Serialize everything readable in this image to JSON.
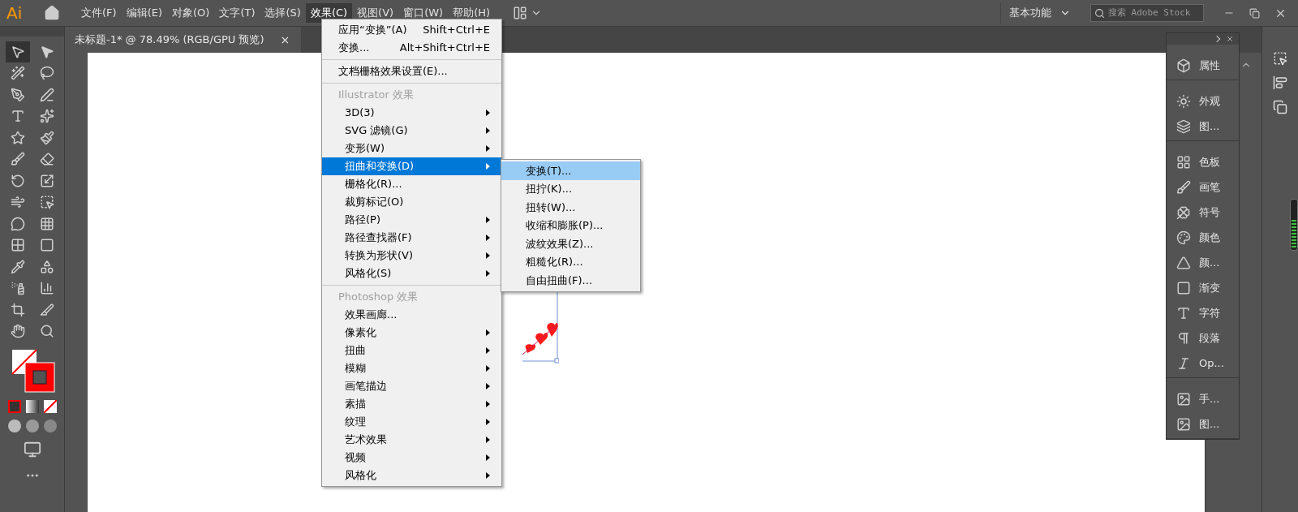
{
  "app_logo": "Ai",
  "menu_bar": [
    {
      "label": "文件(F)",
      "selected": false
    },
    {
      "label": "编辑(E)",
      "selected": false
    },
    {
      "label": "对象(O)",
      "selected": false
    },
    {
      "label": "文字(T)",
      "selected": false
    },
    {
      "label": "选择(S)",
      "selected": false
    },
    {
      "label": "效果(C)",
      "selected": true
    },
    {
      "label": "视图(V)",
      "selected": false
    },
    {
      "label": "窗口(W)",
      "selected": false
    },
    {
      "label": "帮助(H)",
      "selected": false
    }
  ],
  "workspace": "基本功能",
  "search": {
    "placeholder": "搜索 Adobe Stock"
  },
  "document_tab": {
    "title": "未标题-1* @ 78.49% (RGB/GPU 预览)",
    "close": "×"
  },
  "tools": [
    {
      "selected": true
    },
    {
      "selected": false
    },
    {
      "selected": false
    },
    {
      "selected": false
    },
    {
      "selected": false
    },
    {
      "selected": false
    },
    {
      "selected": false
    },
    {
      "selected": false
    },
    {
      "selected": false
    },
    {
      "selected": false
    },
    {
      "selected": false
    },
    {
      "selected": false
    },
    {
      "selected": false
    },
    {
      "selected": false
    },
    {
      "selected": false
    },
    {
      "selected": false
    },
    {
      "selected": false
    },
    {
      "selected": false
    },
    {
      "selected": false
    },
    {
      "selected": false
    },
    {
      "selected": false
    },
    {
      "selected": false
    },
    {
      "selected": false
    },
    {
      "selected": false
    },
    {
      "selected": false
    },
    {
      "selected": false
    },
    {
      "selected": false
    },
    {
      "selected": false
    }
  ],
  "effect_menu": {
    "sections": [
      {
        "items": [
          {
            "label": "应用“变换”(A)",
            "shortcut": "Shift+Ctrl+E",
            "submenu": false,
            "selected": false
          },
          {
            "label": "变换...",
            "shortcut": "Alt+Shift+Ctrl+E",
            "submenu": false,
            "selected": false
          }
        ]
      },
      {
        "items": [
          {
            "label": "文档栅格效果设置(E)...",
            "submenu": false,
            "selected": false
          }
        ]
      },
      {
        "header": "Illustrator 效果",
        "items": [
          {
            "label": "3D(3)",
            "submenu": true,
            "selected": false
          },
          {
            "label": "SVG 滤镜(G)",
            "submenu": true,
            "selected": false
          },
          {
            "label": "变形(W)",
            "submenu": true,
            "selected": false
          },
          {
            "label": "扭曲和变换(D)",
            "submenu": true,
            "selected": true
          },
          {
            "label": "栅格化(R)...",
            "submenu": false,
            "selected": false
          },
          {
            "label": "裁剪标记(O)",
            "submenu": false,
            "selected": false
          },
          {
            "label": "路径(P)",
            "submenu": true,
            "selected": false
          },
          {
            "label": "路径查找器(F)",
            "submenu": true,
            "selected": false
          },
          {
            "label": "转换为形状(V)",
            "submenu": true,
            "selected": false
          },
          {
            "label": "风格化(S)",
            "submenu": true,
            "selected": false
          }
        ]
      },
      {
        "header": "Photoshop 效果",
        "items": [
          {
            "label": "效果画廊...",
            "submenu": false,
            "selected": false
          },
          {
            "label": "像素化",
            "submenu": true,
            "selected": false
          },
          {
            "label": "扭曲",
            "submenu": true,
            "selected": false
          },
          {
            "label": "模糊",
            "submenu": true,
            "selected": false
          },
          {
            "label": "画笔描边",
            "submenu": true,
            "selected": false
          },
          {
            "label": "素描",
            "submenu": true,
            "selected": false
          },
          {
            "label": "纹理",
            "submenu": true,
            "selected": false
          },
          {
            "label": "艺术效果",
            "submenu": true,
            "selected": false
          },
          {
            "label": "视频",
            "submenu": true,
            "selected": false
          },
          {
            "label": "风格化",
            "submenu": true,
            "selected": false
          }
        ]
      }
    ]
  },
  "distort_submenu": [
    {
      "label": "变换(T)...",
      "selected": true
    },
    {
      "label": "扭拧(K)...",
      "selected": false
    },
    {
      "label": "扭转(W)...",
      "selected": false
    },
    {
      "label": "收缩和膨胀(P)...",
      "selected": false
    },
    {
      "label": "波纹效果(Z)...",
      "selected": false
    },
    {
      "label": "粗糙化(R)...",
      "selected": false
    },
    {
      "label": "自由扭曲(F)...",
      "selected": false
    }
  ],
  "panel_dock": {
    "groups": [
      {
        "items": [
          {
            "label": "属性"
          }
        ]
      },
      {
        "items": [
          {
            "label": "外观"
          },
          {
            "label": "图..."
          }
        ]
      },
      {
        "items": [
          {
            "label": "色板"
          },
          {
            "label": "画笔"
          },
          {
            "label": "符号"
          },
          {
            "label": "颜色"
          },
          {
            "label": "颜..."
          },
          {
            "label": "渐变"
          },
          {
            "label": "字符"
          },
          {
            "label": "段落"
          },
          {
            "label": "Op..."
          }
        ]
      },
      {
        "items": [
          {
            "label": "手..."
          },
          {
            "label": "图..."
          }
        ]
      }
    ]
  }
}
